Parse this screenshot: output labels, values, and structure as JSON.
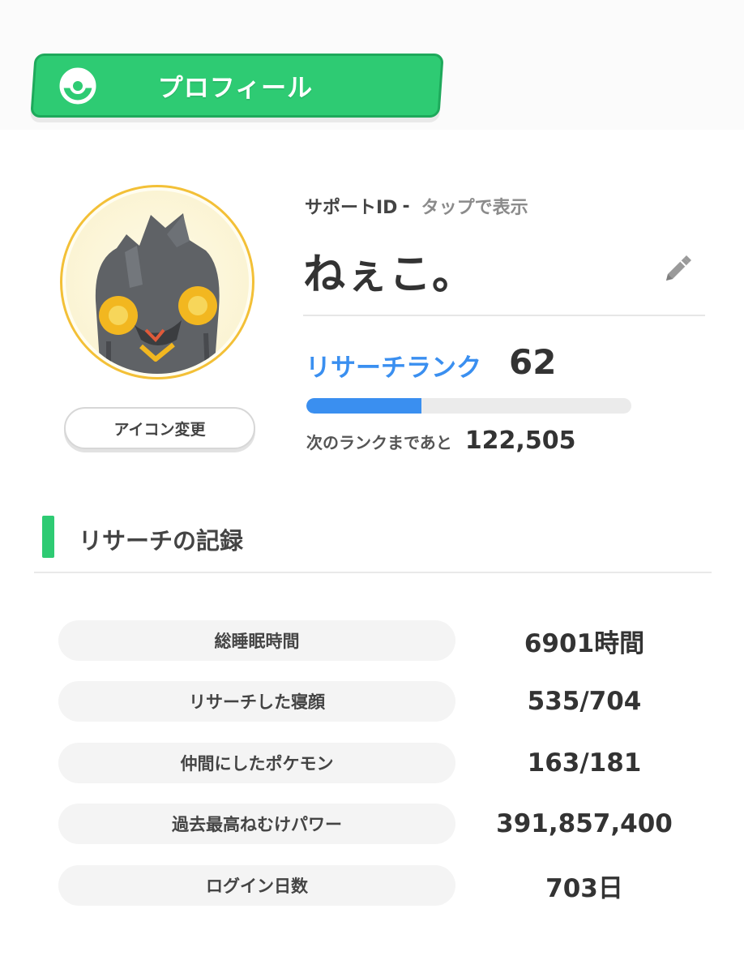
{
  "header": {
    "title": "プロフィール",
    "icon": "pokeball-icon",
    "color": "#2ecb73"
  },
  "profile": {
    "avatar_icon": "dark-pokemon-avatar",
    "icon_change_label": "アイコン変更",
    "support_id_label": "サポートID",
    "support_id_separator": "-",
    "support_id_action": "タップで表示",
    "name": "ねぇこ。",
    "research_rank_label": "リサーチランク",
    "research_rank_value": "62",
    "rank_progress": 0.355,
    "next_rank_label": "次のランクまであと",
    "next_rank_value": "122,505",
    "accent_color": "#3a8ff0"
  },
  "records": {
    "title": "リサーチの記録",
    "items": [
      {
        "label": "総睡眠時間",
        "value": "6901時間"
      },
      {
        "label": "リサーチした寝顔",
        "value": "535/704"
      },
      {
        "label": "仲間にしたポケモン",
        "value": "163/181"
      },
      {
        "label": "過去最高ねむけパワー",
        "value": "391,857,400"
      },
      {
        "label": "ログイン日数",
        "value": "703日"
      }
    ]
  }
}
